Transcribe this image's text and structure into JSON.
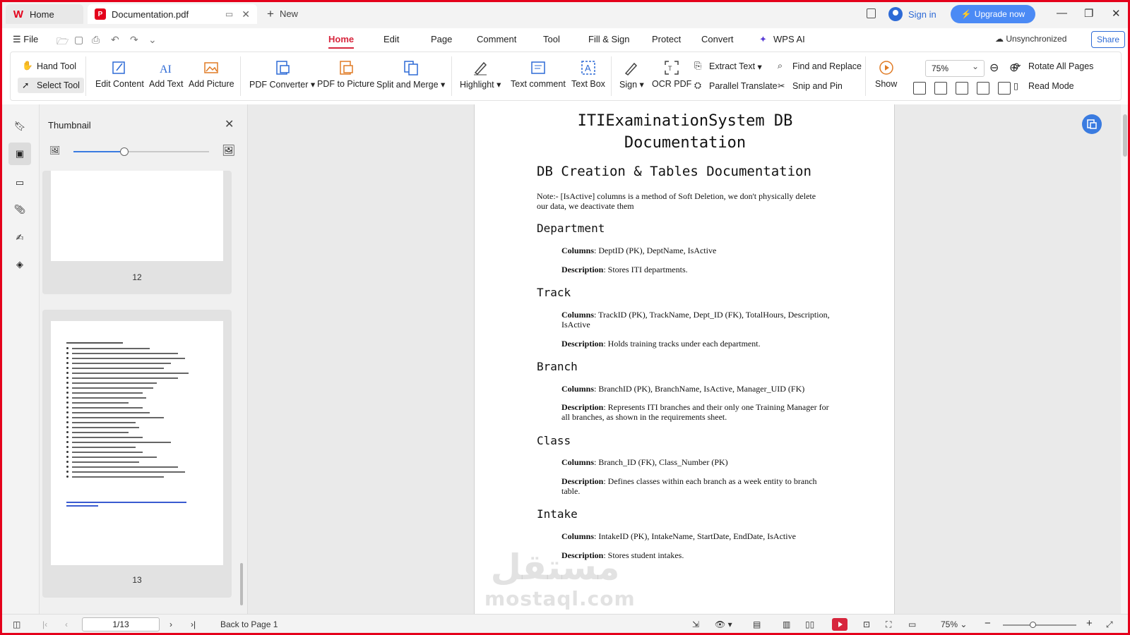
{
  "titlebar": {
    "home_tab": "Home",
    "doc_tab": "Documentation.pdf",
    "new_tab": "New",
    "sign_in": "Sign in",
    "upgrade": "Upgrade now"
  },
  "menubar": {
    "file": "File",
    "tabs": [
      "Home",
      "Edit",
      "Page",
      "Comment",
      "Tool",
      "Fill & Sign",
      "Protect",
      "Convert",
      "WPS AI"
    ],
    "active_tab": "Home",
    "unsync": "Unsynchronized",
    "share": "Share"
  },
  "ribbon": {
    "hand_tool": "Hand Tool",
    "select_tool": "Select Tool",
    "edit_content": "Edit Content",
    "add_text": "Add Text",
    "add_picture": "Add Picture",
    "pdf_converter": "PDF Converter",
    "pdf_to_picture": "PDF to Picture",
    "split_merge": "Split and Merge",
    "highlight": "Highlight",
    "text_comment": "Text comment",
    "text_box": "Text Box",
    "sign": "Sign",
    "ocr_pdf": "OCR PDF",
    "extract_text": "Extract Text",
    "parallel_translate": "Parallel Translate",
    "find_replace": "Find and Replace",
    "snip_pin": "Snip and Pin",
    "show": "Show",
    "zoom": "75%",
    "rotate_all": "Rotate All Pages",
    "read_mode": "Read Mode"
  },
  "thumbnail_panel": {
    "title": "Thumbnail",
    "page_a": "12",
    "page_b": "13"
  },
  "document": {
    "title": "ITIExaminationSystem DB Documentation",
    "section": "DB Creation & Tables Documentation",
    "note": "Note:- [IsActive] columns is a method of Soft Deletion, we don't physically delete our data, we deactivate them",
    "columns_label": "Columns",
    "description_label": "Description",
    "tables": [
      {
        "name": "Department",
        "columns": ": DeptID (PK), DeptName, IsActive",
        "description": ": Stores ITI departments."
      },
      {
        "name": "Track",
        "columns": ": TrackID (PK), TrackName, Dept_ID (FK), TotalHours, Description, IsActive",
        "description": ": Holds training tracks under each department."
      },
      {
        "name": "Branch",
        "columns": ": BranchID (PK), BranchName, IsActive, Manager_UID (FK)",
        "description": ": Represents ITI branches and their only one Training Manager for all branches, as shown in the requirements sheet."
      },
      {
        "name": "Class",
        "columns": ": Branch_ID (FK), Class_Number (PK)",
        "description": ": Defines classes within each branch as a week entity to branch table."
      },
      {
        "name": "Intake",
        "columns": ": IntakeID (PK), IntakeName, StartDate, EndDate, IsActive",
        "description": ": Stores student intakes."
      }
    ],
    "watermark_ar": "مستقل",
    "watermark_en": "mostaql.com"
  },
  "statusbar": {
    "page": "1/13",
    "back_to": "Back to Page 1",
    "zoom": "75%"
  },
  "colors": {
    "accent": "#d7263d",
    "brand_red": "#e4001b",
    "link_blue": "#2d6ad6",
    "upgrade_bg": "#4b8af5"
  }
}
